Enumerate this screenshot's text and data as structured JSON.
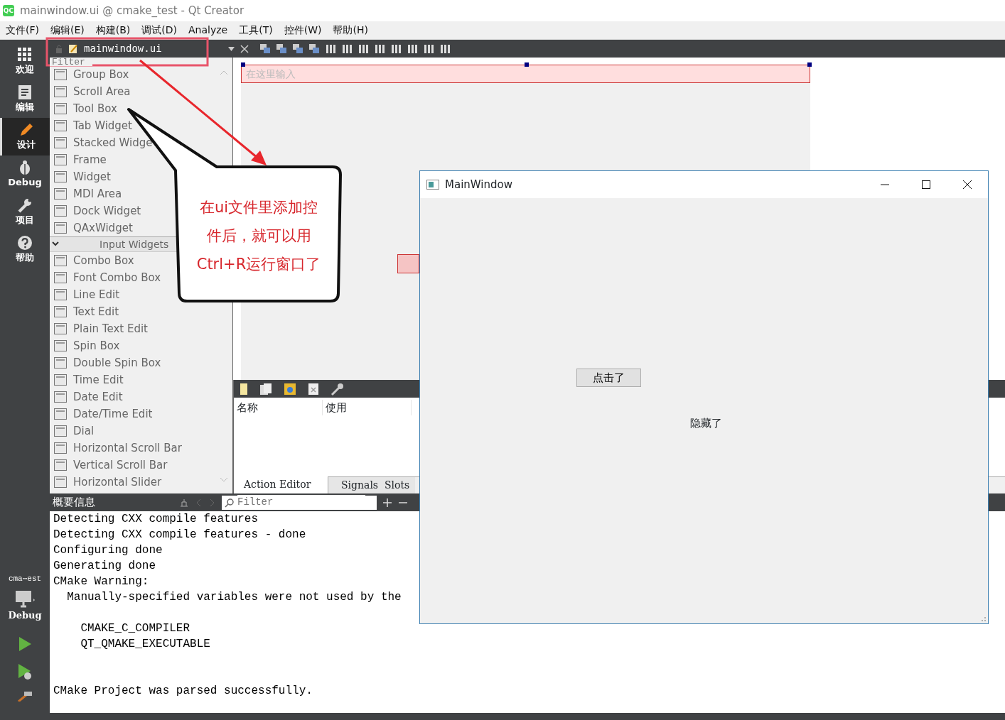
{
  "window": {
    "logo": "QC",
    "title": "mainwindow.ui @ cmake_test - Qt Creator"
  },
  "menu": [
    "文件(F)",
    "编辑(E)",
    "构建(B)",
    "调试(D)",
    "Analyze",
    "工具(T)",
    "控件(W)",
    "帮助(H)"
  ],
  "modes": [
    {
      "label": "欢迎",
      "selected": false
    },
    {
      "label": "编辑",
      "selected": false
    },
    {
      "label": "设计",
      "selected": true
    },
    {
      "label": "Debug",
      "selected": false
    },
    {
      "label": "项目",
      "selected": false
    },
    {
      "label": "帮助",
      "selected": false
    }
  ],
  "kit": {
    "project": "cma⋯est",
    "build": "Debug"
  },
  "editor_tab": {
    "file": "mainwindow.ui"
  },
  "widget_box": {
    "filter_placeholder": "Filter",
    "items": [
      {
        "kind": "item",
        "label": "Group Box"
      },
      {
        "kind": "item",
        "label": "Scroll Area"
      },
      {
        "kind": "item",
        "label": "Tool Box"
      },
      {
        "kind": "item",
        "label": "Tab Widget"
      },
      {
        "kind": "item",
        "label": "Stacked Widge"
      },
      {
        "kind": "item",
        "label": "Frame"
      },
      {
        "kind": "item",
        "label": "Widget"
      },
      {
        "kind": "item",
        "label": "MDI Area"
      },
      {
        "kind": "item",
        "label": "Dock Widget"
      },
      {
        "kind": "item",
        "label": "QAxWidget"
      },
      {
        "kind": "category",
        "label": "Input Widgets",
        "expanded": true
      },
      {
        "kind": "item",
        "label": "Combo Box"
      },
      {
        "kind": "item",
        "label": "Font Combo Box"
      },
      {
        "kind": "item",
        "label": "Line Edit"
      },
      {
        "kind": "item",
        "label": "Text Edit"
      },
      {
        "kind": "item",
        "label": "Plain Text Edit"
      },
      {
        "kind": "item",
        "label": "Spin Box"
      },
      {
        "kind": "item",
        "label": "Double Spin Box"
      },
      {
        "kind": "item",
        "label": "Time Edit"
      },
      {
        "kind": "item",
        "label": "Date Edit"
      },
      {
        "kind": "item",
        "label": "Date/Time Edit"
      },
      {
        "kind": "item",
        "label": "Dial"
      },
      {
        "kind": "item",
        "label": "Horizontal Scroll Bar"
      },
      {
        "kind": "item",
        "label": "Vertical Scroll Bar"
      },
      {
        "kind": "item",
        "label": "Horizontal Slider"
      }
    ]
  },
  "form": {
    "line_edit_placeholder": "在这里输入"
  },
  "action_editor": {
    "columns": [
      "名称",
      "使用"
    ],
    "tabs": [
      {
        "label": "Action Editor",
        "selected": true
      },
      {
        "label": "Signals  Slots",
        "selected": false
      }
    ]
  },
  "output": {
    "title": "概要信息",
    "filter_placeholder": "Filter",
    "blocks": [
      [
        "Detecting CXX compile features",
        "Detecting CXX compile features - done",
        "Configuring done",
        "Generating done",
        "CMake Warning:",
        "  Manually-specified variables were not used by the"
      ],
      [
        "    CMAKE_C_COMPILER",
        "    QT_QMAKE_EXECUTABLE"
      ],
      [
        "CMake Project was parsed successfully."
      ]
    ]
  },
  "callout": {
    "lines": [
      "在ui文件里添加控",
      "件后，就可以用",
      "Ctrl+R运行窗口了"
    ]
  },
  "app_window": {
    "title": "MainWindow",
    "button": "点击了",
    "label": "隐藏了"
  }
}
